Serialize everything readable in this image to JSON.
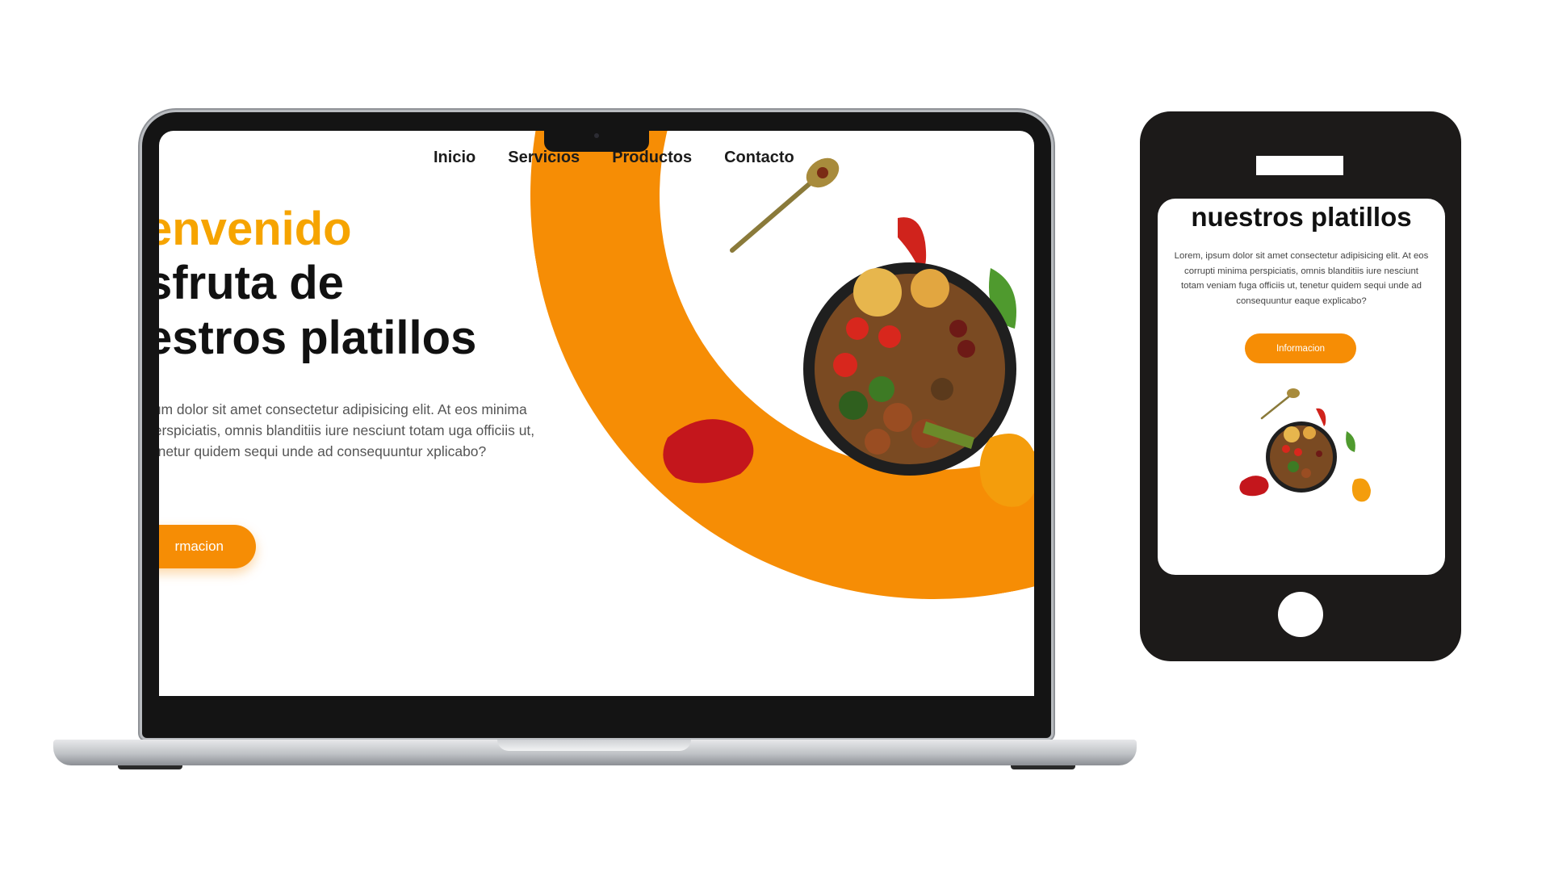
{
  "laptop": {
    "nav": [
      "Inicio",
      "Servicios",
      "Productos",
      "Contacto"
    ],
    "welcome": "envenido",
    "title_line1": "sfruta de",
    "title_line2": "estros platillos",
    "paragraph": "sum dolor sit amet consectetur adipisicing elit. At eos minima perspiciatis, omnis blanditiis iure nesciunt totam uga officiis ut, tenetur quidem sequi unde ad consequuntur xplicabo?",
    "button": "rmacion"
  },
  "mobile": {
    "title": "nuestros platillos",
    "paragraph": "Lorem, ipsum dolor sit amet consectetur adipisicing elit. At eos corrupti minima perspiciatis, omnis blanditiis iure nesciunt totam veniam fuga officiis ut, tenetur quidem sequi unde ad consequuntur eaque explicabo?",
    "button": "Informacion"
  },
  "colors": {
    "accent": "#f68d05",
    "welcome": "#f6a400",
    "device": "#1c1a19"
  },
  "icons": [
    "spoon-icon",
    "chili-pepper-icon",
    "food-bowl-icon",
    "basil-leaf-icon",
    "red-bell-pepper-icon",
    "orange-bell-pepper-icon"
  ]
}
